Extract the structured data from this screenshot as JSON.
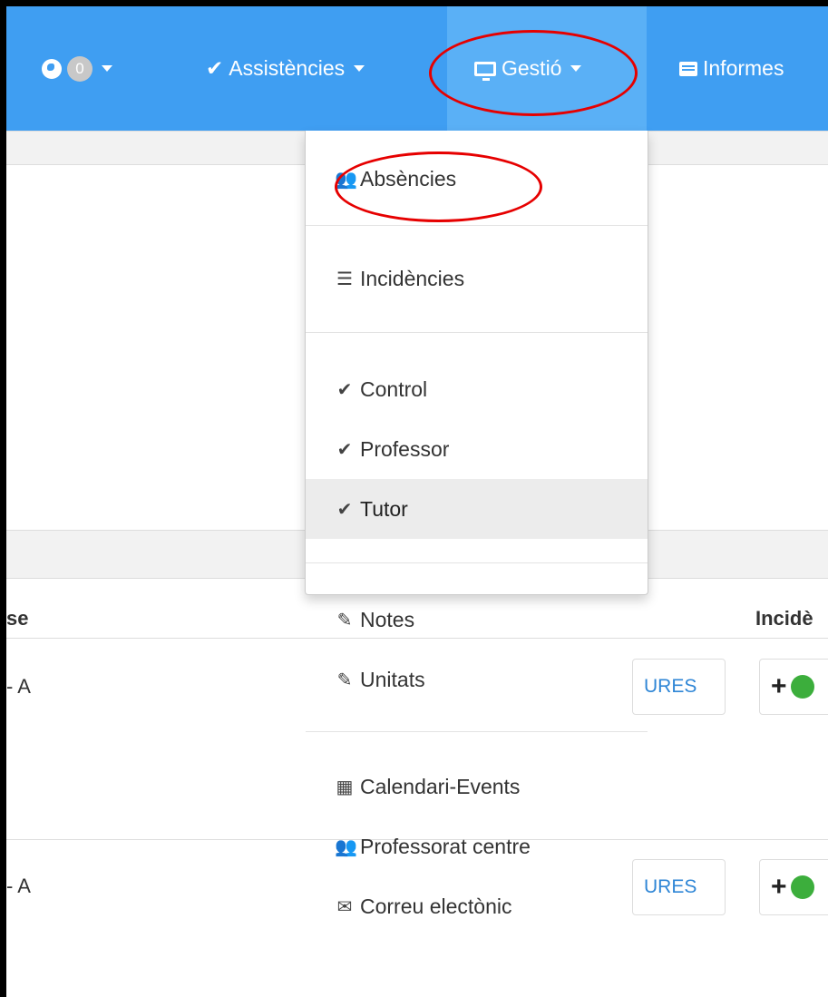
{
  "navbar": {
    "notifications_count": "0",
    "assistencies_label": "Assistències",
    "gestio_label": "Gestió",
    "informes_label": "Informes"
  },
  "dropdown": {
    "items": [
      {
        "label": "Absències",
        "icon": "user-group-icon"
      },
      {
        "label": "Incidències",
        "icon": "list-icon"
      },
      {
        "label": "Control",
        "icon": "check-icon"
      },
      {
        "label": "Professor",
        "icon": "check-icon"
      },
      {
        "label": "Tutor",
        "icon": "check-icon",
        "active": true
      },
      {
        "label": "Notes",
        "icon": "edit-icon"
      },
      {
        "label": "Unitats",
        "icon": "edit-icon"
      },
      {
        "label": "Calendari-Events",
        "icon": "grid-icon"
      },
      {
        "label": "Professorat centre",
        "icon": "users-icon"
      },
      {
        "label": "Correu electònic",
        "icon": "envelope-icon"
      }
    ]
  },
  "table": {
    "header_left": "se",
    "header_right": "Incidè",
    "rows": [
      {
        "left": "- A",
        "button": "URES"
      },
      {
        "left": "- A",
        "button": "URES"
      }
    ]
  },
  "colors": {
    "navbar": "#3f9ef2",
    "annotation": "#e60000",
    "active_item": "#ececec"
  }
}
